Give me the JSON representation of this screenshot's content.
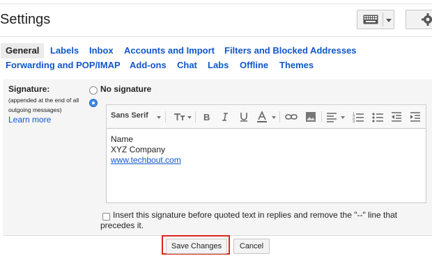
{
  "header": {
    "title": "Settings"
  },
  "tabs": [
    {
      "label": "General",
      "active": true
    },
    {
      "label": "Labels"
    },
    {
      "label": "Inbox"
    },
    {
      "label": "Accounts and Import"
    },
    {
      "label": "Filters and Blocked Addresses"
    },
    {
      "label": "Forwarding and POP/IMAP"
    },
    {
      "label": "Add-ons"
    },
    {
      "label": "Chat"
    },
    {
      "label": "Labs"
    },
    {
      "label": "Offline"
    },
    {
      "label": "Themes"
    }
  ],
  "signature": {
    "label": "Signature:",
    "note": "(appended at the end of all outgoing messages)",
    "learn_more": "Learn more",
    "option_none": "No signature",
    "selected": "custom"
  },
  "toolbar": {
    "font": "Sans Serif"
  },
  "editor": {
    "lines": [
      "Name",
      "XYZ Company"
    ],
    "link": "www.techbout.com"
  },
  "insert_before": {
    "label": "Insert this signature before quoted text in replies and remove the \"--\" line that precedes it.",
    "checked": false
  },
  "buttons": {
    "save": "Save Changes",
    "cancel": "Cancel"
  },
  "colors": {
    "link": "#1155cc",
    "highlight": "#d9251d",
    "radio_selected": "#3b8ae6"
  }
}
